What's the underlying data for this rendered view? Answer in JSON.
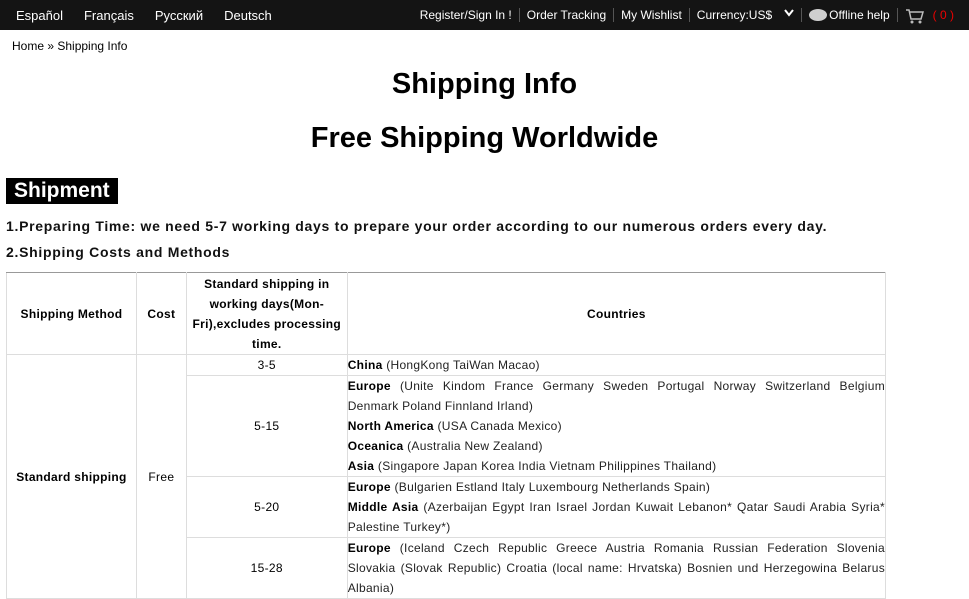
{
  "topbar": {
    "languages": [
      "Español",
      "Français",
      "Русский",
      "Deutsch"
    ],
    "register": "Register/Sign In !",
    "order_tracking": "Order Tracking",
    "wishlist": "My Wishlist",
    "currency": "Currency:US$",
    "offline_help": "Offline help",
    "cart_count": "( 0 )"
  },
  "breadcrumb": {
    "home": "Home",
    "separator": " » ",
    "current": "Shipping Info"
  },
  "page": {
    "title": "Shipping Info",
    "subtitle": "Free Shipping Worldwide",
    "section": "Shipment",
    "p1": "1.Preparing Time: we need 5-7 working days to prepare your order according to our numerous orders every day.",
    "p2": "2.Shipping Costs and Methods"
  },
  "table": {
    "headers": {
      "method": "Shipping Method",
      "cost": "Cost",
      "days": "Standard shipping in working days(Mon-Fri),excludes processing time.",
      "countries": "Countries"
    },
    "method": "Standard shipping",
    "cost": "Free",
    "rows": [
      {
        "days": "3-5",
        "lines": [
          {
            "region": "China",
            "list": " (HongKong TaiWan Macao)"
          }
        ]
      },
      {
        "days": "5-15",
        "lines": [
          {
            "region": "Europe",
            "list": " (Unite Kindom France Germany Sweden Portugal Norway Switzerland Belgium Denmark Poland Finnland Irland)"
          },
          {
            "region": "North America",
            "list": " (USA Canada Mexico)"
          },
          {
            "region": "Oceanica",
            "list": " (Australia New Zealand)"
          },
          {
            "region": "Asia",
            "list": " (Singapore Japan Korea India Vietnam Philippines Thailand)"
          }
        ]
      },
      {
        "days": "5-20",
        "lines": [
          {
            "region": "Europe",
            "list": " (Bulgarien Estland Italy Luxembourg Netherlands Spain)"
          },
          {
            "region": "Middle Asia",
            "list": " (Azerbaijan Egypt Iran Israel Jordan Kuwait Lebanon* Qatar Saudi Arabia Syria* Palestine Turkey*)"
          }
        ]
      },
      {
        "days": "15-28",
        "lines": [
          {
            "region": "Europe",
            "list": " (Iceland Czech Republic Greece Austria Romania Russian Federation Slovenia Slovakia (Slovak Republic) Croatia (local name: Hrvatska) Bosnien und Herzegowina Belarus Albania)"
          }
        ]
      }
    ]
  }
}
